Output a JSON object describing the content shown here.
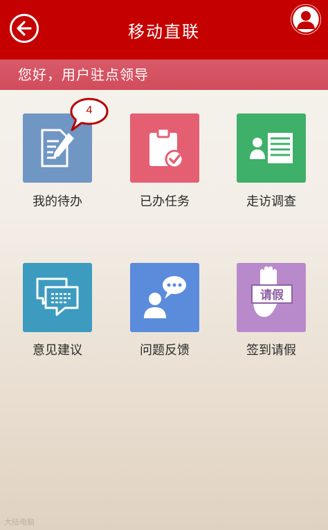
{
  "header": {
    "title": "移动直联"
  },
  "greeting": "您好，用户驻点领导",
  "tiles": [
    {
      "label": "我的待办",
      "color": "#7096c4",
      "icon": "edit-document-icon",
      "badge": "4"
    },
    {
      "label": "已办任务",
      "color": "#e45f72",
      "icon": "clipboard-check-icon"
    },
    {
      "label": "走访调查",
      "color": "#3eb06a",
      "icon": "person-list-icon"
    },
    {
      "label": "意见建议",
      "color": "#3d9bc0",
      "icon": "chat-bubbles-icon"
    },
    {
      "label": "问题反馈",
      "color": "#5b8bdb",
      "icon": "person-speech-icon"
    },
    {
      "label": "签到请假",
      "color": "#b98acb",
      "icon": "hand-sign-icon",
      "sign_text": "请假"
    }
  ],
  "watermark": "大陆电脑"
}
